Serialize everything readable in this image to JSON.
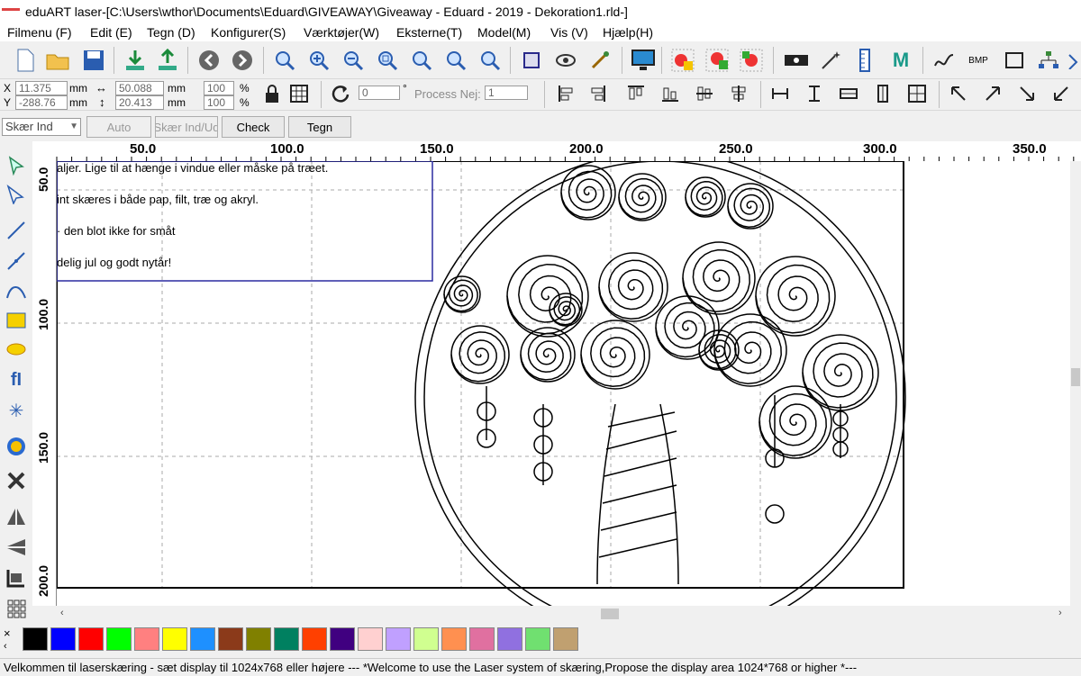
{
  "window": {
    "title": "eduART laser-[C:\\Users\\wthor\\Documents\\Eduard\\GIVEAWAY\\Giveaway - Eduard - 2019 - Dekoration1.rld-]"
  },
  "menu": [
    "Filmenu (F)",
    "Edit (E)",
    "Tegn (D)",
    "Konfigurer(S)",
    "Værktøjer(W)",
    "Eksterne(T)",
    "Model(M)",
    "Vis (V)",
    "Hjælp(H)"
  ],
  "toolbar": {
    "bmp_label": "BMP",
    "m_label": "M"
  },
  "coords": {
    "x_label": "X",
    "y_label": "Y",
    "x_value": "11.375",
    "y_value": "-288.76",
    "x_unit": "mm",
    "y_unit": "mm",
    "width_value": "50.088",
    "height_value": "20.413",
    "w_unit": "mm",
    "h_unit": "mm",
    "scale_x": "100",
    "scale_y": "100",
    "pct_x": "%",
    "pct_y": "%"
  },
  "rotate": {
    "value": "0",
    "degree": "°"
  },
  "process": {
    "label": "Process Nej:",
    "value": "1"
  },
  "cut_toolbar": {
    "mode_value": "Skær Ind",
    "auto_label": "Auto",
    "cut_in_label": "Skær Ind/Ud",
    "check_label": "Check",
    "draw_label": "Tegn"
  },
  "ruler": {
    "h": [
      "50.0",
      "100.0",
      "150.0",
      "200.0",
      "250.0",
      "300.0",
      "350.0"
    ],
    "v": [
      "50.0",
      "100.0",
      "150.0",
      "200.0"
    ]
  },
  "document_text": [
    "aljer. Lige til at hænge i vindue eller måske på træet.",
    "int skæres i både pap, filt, træ og akryl.",
    "· den blot ikke for småt",
    "delig jul og godt nytår!"
  ],
  "palette": [
    "#000000",
    "#0000ff",
    "#ff0000",
    "#00ff00",
    "#ff8080",
    "#ffff00",
    "#1e90ff",
    "#8b3a1a",
    "#808000",
    "#008060",
    "#ff4000",
    "#400080",
    "#ffd0d0",
    "#c0a0ff",
    "#d0ff90",
    "#ff9050",
    "#e070a0",
    "#9070e0",
    "#70e070",
    "#c0a070"
  ],
  "palette_close": "×",
  "status": "Velkommen til laserskæring - sæt display til 1024x768 eller højere --- *Welcome to use the Laser system of skæring,Propose the display area 1024*768 or higher *---"
}
